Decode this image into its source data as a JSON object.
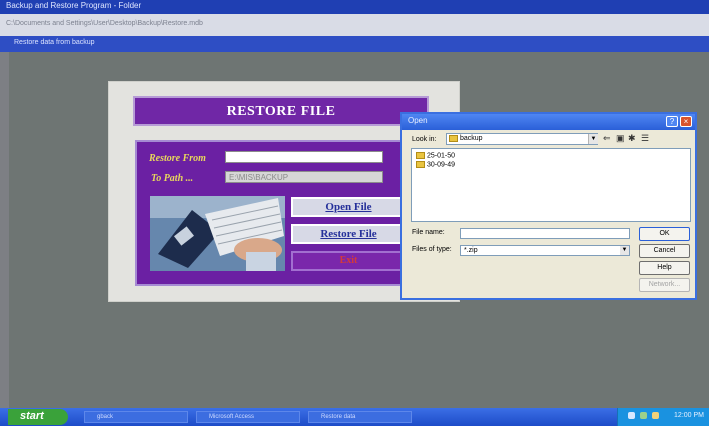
{
  "window": {
    "title": "Backup and Restore Program - Folder",
    "address": "C:\\Documents and Settings\\User\\Desktop\\Backup\\Restore.mdb",
    "caption": "Restore data from backup"
  },
  "restore_form": {
    "title": "RESTORE FILE",
    "restore_from_label": "Restore From",
    "restore_from_value": "",
    "to_path_label": "To Path ...",
    "to_path_value": "E:\\MIS\\BACKUP",
    "open_file_label": "Open File",
    "restore_file_label": "Restore File",
    "exit_label": "Exit"
  },
  "open_dialog": {
    "title": "Open",
    "look_in_label": "Look in:",
    "look_in_value": "backup",
    "files": [
      "25-01-50",
      "30-09-49"
    ],
    "file_name_label": "File name:",
    "file_name_value": "",
    "files_of_type_label": "Files of type:",
    "files_of_type_value": "*.zip",
    "ok_label": "OK",
    "cancel_label": "Cancel",
    "help_label": "Help",
    "network_label": "Network..."
  },
  "taskbar": {
    "start_label": "start",
    "items": [
      "gback",
      "Microsoft Access",
      "Restore data"
    ],
    "clock": "12:00 PM"
  },
  "colors": {
    "form_purple": "#6b20a3",
    "label_yellow": "#e8d85c",
    "xp_blue": "#2a5fd8",
    "desktop_grey": "#6e7573"
  }
}
